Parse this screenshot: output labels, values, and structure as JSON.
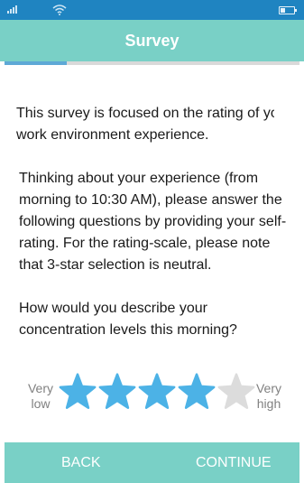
{
  "header": {
    "title": "Survey"
  },
  "progress": {
    "fraction": 0.21
  },
  "content": {
    "intro": "This survey is focused on the rating of your work environment experience.",
    "instructions": "Thinking about your experience (from morning to 10:30 AM), please answer the following questions by providing your self-rating.  For the rating-scale, please note that 3-star selection is neutral.",
    "question": "How would you describe your concentration levels this morning?"
  },
  "rating": {
    "low_label": "Very low",
    "high_label": "Very high",
    "max": 5,
    "value": 4,
    "filled_color": "#4cb2e6",
    "empty_color": "#dcdcdc"
  },
  "footer": {
    "back_label": "BACK",
    "continue_label": "CONTINUE"
  },
  "colors": {
    "accent": "#79d0c6",
    "status_bar": "#1f84c1",
    "progress": "#5ea9d6"
  }
}
